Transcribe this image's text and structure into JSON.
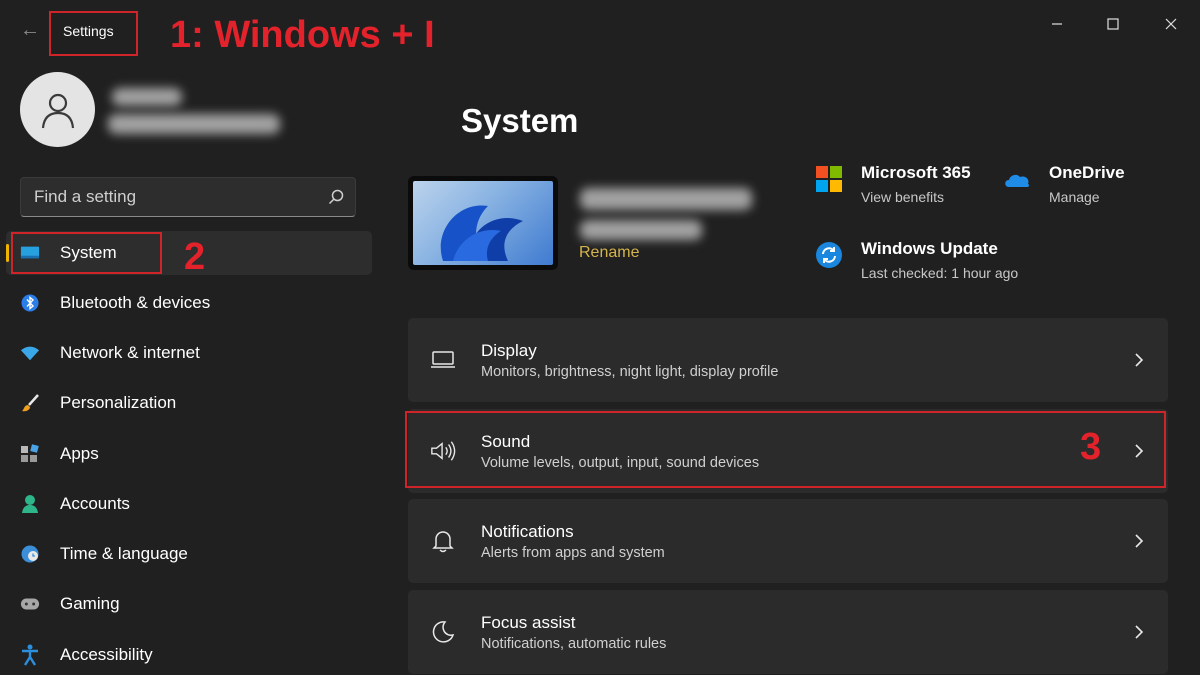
{
  "window": {
    "title": "Settings",
    "controls": {
      "minimize": "—",
      "maximize": "☐",
      "close": "✕"
    }
  },
  "annotations": {
    "step1": "1: Windows + I",
    "step2": "2",
    "step3": "3",
    "color": "#e3222b"
  },
  "search": {
    "placeholder": "Find a setting"
  },
  "sidebar": {
    "items": [
      {
        "label": "System",
        "icon": "system-icon",
        "selected": true
      },
      {
        "label": "Bluetooth & devices",
        "icon": "bluetooth-icon"
      },
      {
        "label": "Network & internet",
        "icon": "wifi-icon"
      },
      {
        "label": "Personalization",
        "icon": "brush-icon"
      },
      {
        "label": "Apps",
        "icon": "apps-icon"
      },
      {
        "label": "Accounts",
        "icon": "person-icon"
      },
      {
        "label": "Time & language",
        "icon": "globe-clock-icon"
      },
      {
        "label": "Gaming",
        "icon": "gamepad-icon"
      },
      {
        "label": "Accessibility",
        "icon": "accessibility-icon"
      }
    ],
    "accent": "#f0b300"
  },
  "main": {
    "title": "System",
    "device": {
      "rename": "Rename"
    },
    "quick_links": [
      {
        "title": "Microsoft 365",
        "subtitle": "View benefits",
        "icon": "microsoft-logo-icon"
      },
      {
        "title": "OneDrive",
        "subtitle": "Manage",
        "icon": "onedrive-cloud-icon"
      },
      {
        "title": "Windows Update",
        "subtitle": "Last checked: 1 hour ago",
        "icon": "windows-update-icon"
      }
    ],
    "cards": [
      {
        "title": "Display",
        "subtitle": "Monitors, brightness, night light, display profile",
        "icon": "monitor-icon"
      },
      {
        "title": "Sound",
        "subtitle": "Volume levels, output, input, sound devices",
        "icon": "speaker-icon"
      },
      {
        "title": "Notifications",
        "subtitle": "Alerts from apps and system",
        "icon": "bell-icon"
      },
      {
        "title": "Focus assist",
        "subtitle": "Notifications, automatic rules",
        "icon": "moon-icon"
      }
    ]
  }
}
